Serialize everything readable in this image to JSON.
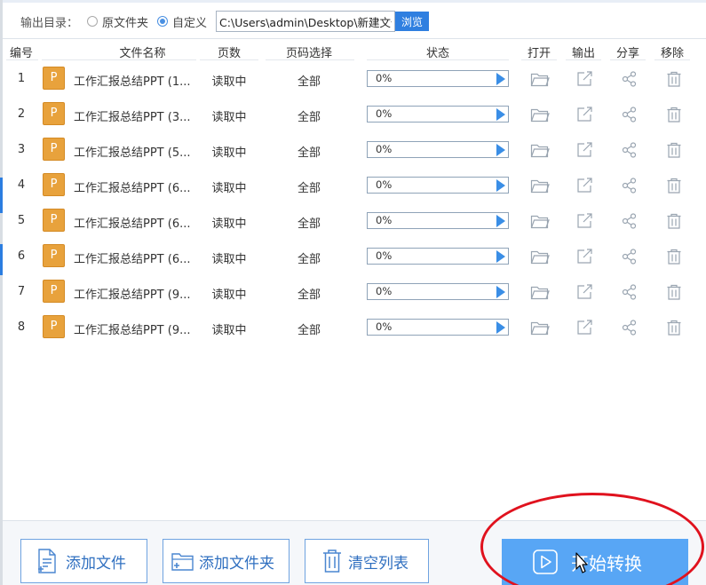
{
  "output_bar": {
    "label": "输出目录：",
    "option_original": "原文件夹",
    "option_custom": "自定义",
    "path_value": "C:\\Users\\admin\\Desktop\\新建文件",
    "browse_label": "浏览",
    "selected": "custom"
  },
  "table": {
    "headers": {
      "num": "编号",
      "name": "文件名称",
      "pages": "页数",
      "range": "页码选择",
      "status": "状态",
      "open": "打开",
      "output": "输出",
      "share": "分享",
      "remove": "移除"
    },
    "rows": [
      {
        "num": "1",
        "icon_letter": "P",
        "name": "工作汇报总结PPT (1...",
        "pages": "读取中",
        "range": "全部",
        "progress_text": "0%",
        "progress": 0
      },
      {
        "num": "2",
        "icon_letter": "P",
        "name": "工作汇报总结PPT (3...",
        "pages": "读取中",
        "range": "全部",
        "progress_text": "0%",
        "progress": 0
      },
      {
        "num": "3",
        "icon_letter": "P",
        "name": "工作汇报总结PPT (5...",
        "pages": "读取中",
        "range": "全部",
        "progress_text": "0%",
        "progress": 0
      },
      {
        "num": "4",
        "icon_letter": "P",
        "name": "工作汇报总结PPT (6...",
        "pages": "读取中",
        "range": "全部",
        "progress_text": "0%",
        "progress": 0
      },
      {
        "num": "5",
        "icon_letter": "P",
        "name": "工作汇报总结PPT (6...",
        "pages": "读取中",
        "range": "全部",
        "progress_text": "0%",
        "progress": 0
      },
      {
        "num": "6",
        "icon_letter": "P",
        "name": "工作汇报总结PPT (6...",
        "pages": "读取中",
        "range": "全部",
        "progress_text": "0%",
        "progress": 0
      },
      {
        "num": "7",
        "icon_letter": "P",
        "name": "工作汇报总结PPT (9...",
        "pages": "读取中",
        "range": "全部",
        "progress_text": "0%",
        "progress": 0
      },
      {
        "num": "8",
        "icon_letter": "P",
        "name": "工作汇报总结PPT (9...",
        "pages": "读取中",
        "range": "全部",
        "progress_text": "0%",
        "progress": 0
      }
    ]
  },
  "bottom": {
    "add_file": "添加文件",
    "add_folder": "添加文件夹",
    "clear_list": "清空列表",
    "start": "开始转换"
  },
  "icons": [
    "folder-icon",
    "export-icon",
    "share-icon",
    "trash-icon",
    "file-add-icon",
    "folder-add-icon",
    "play-icon"
  ],
  "colors": {
    "accent": "#2f7fe0",
    "start_button": "#58a6f5",
    "ppt_icon": "#e8a23c",
    "annotation_red": "#e0121e"
  }
}
